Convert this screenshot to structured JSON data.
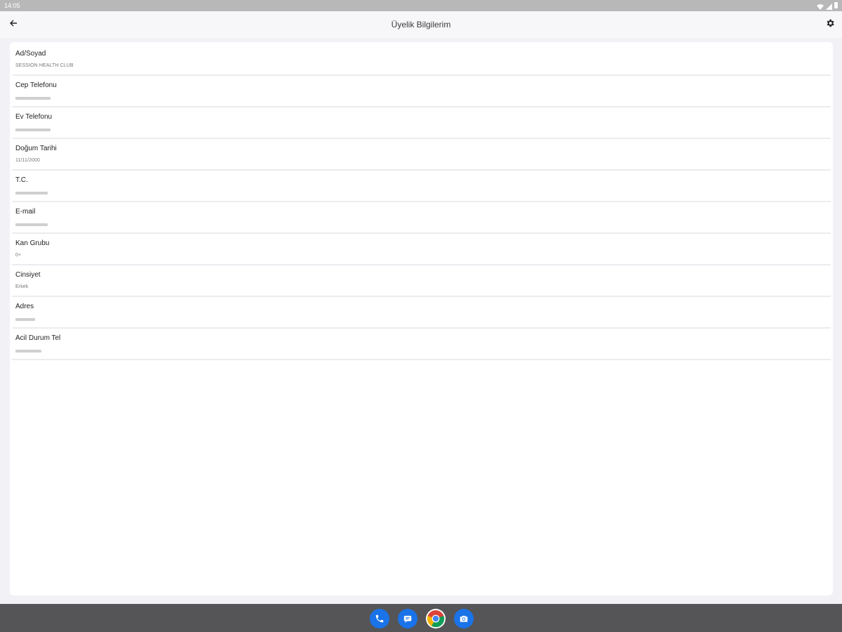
{
  "status_bar": {
    "time": "14:05"
  },
  "app_bar": {
    "title": "Üyelik Bilgilerim",
    "back_icon": "arrow-left-icon",
    "settings_icon": "gear-icon"
  },
  "fields": [
    {
      "label": "Ad/Soyad",
      "value": "SESSION HEALTH CLUB"
    },
    {
      "label": "Cep Telefonu",
      "value": ""
    },
    {
      "label": "Ev Telefonu",
      "value": ""
    },
    {
      "label": "Doğum Tarihi",
      "value": "11/11/2000"
    },
    {
      "label": "T.C.",
      "value": ""
    },
    {
      "label": "E-mail",
      "value": ""
    },
    {
      "label": "Kan Grubu",
      "value": "0+"
    },
    {
      "label": "Cinsiyet",
      "value": "Erkek"
    },
    {
      "label": "Adres",
      "value": ""
    },
    {
      "label": "Acil Durum Tel",
      "value": ""
    }
  ],
  "dock": {
    "apps": [
      "phone-icon",
      "messages-icon",
      "chrome-icon",
      "camera-icon"
    ]
  },
  "colors": {
    "background": "#f2f2f6",
    "card": "#ffffff",
    "dock": "#555557",
    "accent_blue": "#1a73e8"
  }
}
